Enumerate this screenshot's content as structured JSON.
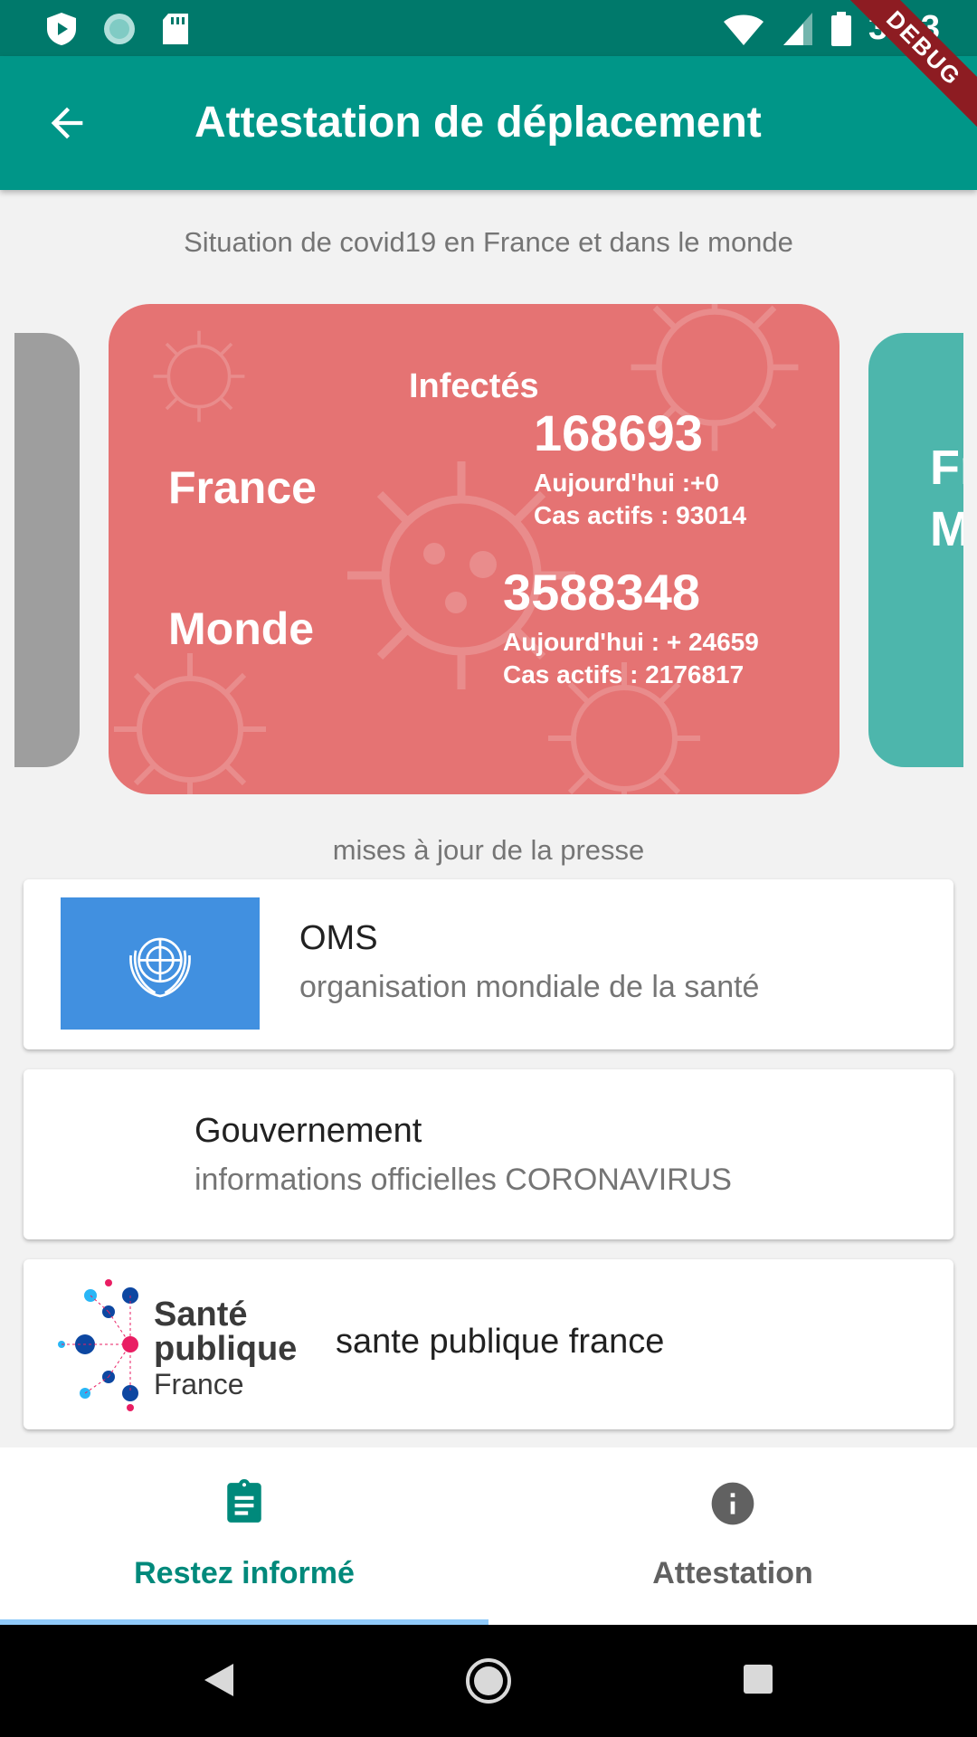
{
  "status_bar": {
    "time": "3:23"
  },
  "debug_banner": "DEBUG",
  "app_bar": {
    "title": "Attestation de déplacement"
  },
  "subtitle": "Situation de covid19 en France et dans le monde",
  "carousel": {
    "main_card": {
      "title": "Infectés",
      "france": {
        "label": "France",
        "total": "168693",
        "today": "Aujourd'hui :+0",
        "active": "Cas actifs :  93014"
      },
      "world": {
        "label": "Monde",
        "total": "3588348",
        "today": "Aujourd'hui : + 24659",
        "active": "Cas actifs :  2176817"
      },
      "color": "#e57373"
    },
    "left_card_color": "#9e9e9e",
    "right_card": {
      "line1": "Fr",
      "line2": "M",
      "color": "#4db6ac"
    }
  },
  "press": {
    "title": "mises à jour de la presse",
    "items": [
      {
        "name": "OMS",
        "description": "organisation mondiale de la santé"
      },
      {
        "name": "Gouvernement",
        "description": "informations officielles CORONAVIRUS"
      },
      {
        "name": "sante publique france"
      }
    ],
    "spf_logo": {
      "line1": "Santé",
      "line2": "publique",
      "line3": "France"
    }
  },
  "bottom_nav": {
    "items": [
      {
        "label": "Restez informé",
        "icon": "clipboard-icon",
        "active": true
      },
      {
        "label": "Attestation",
        "icon": "info-icon",
        "active": false
      }
    ],
    "active_color": "#00897b",
    "inactive_color": "#616161"
  }
}
